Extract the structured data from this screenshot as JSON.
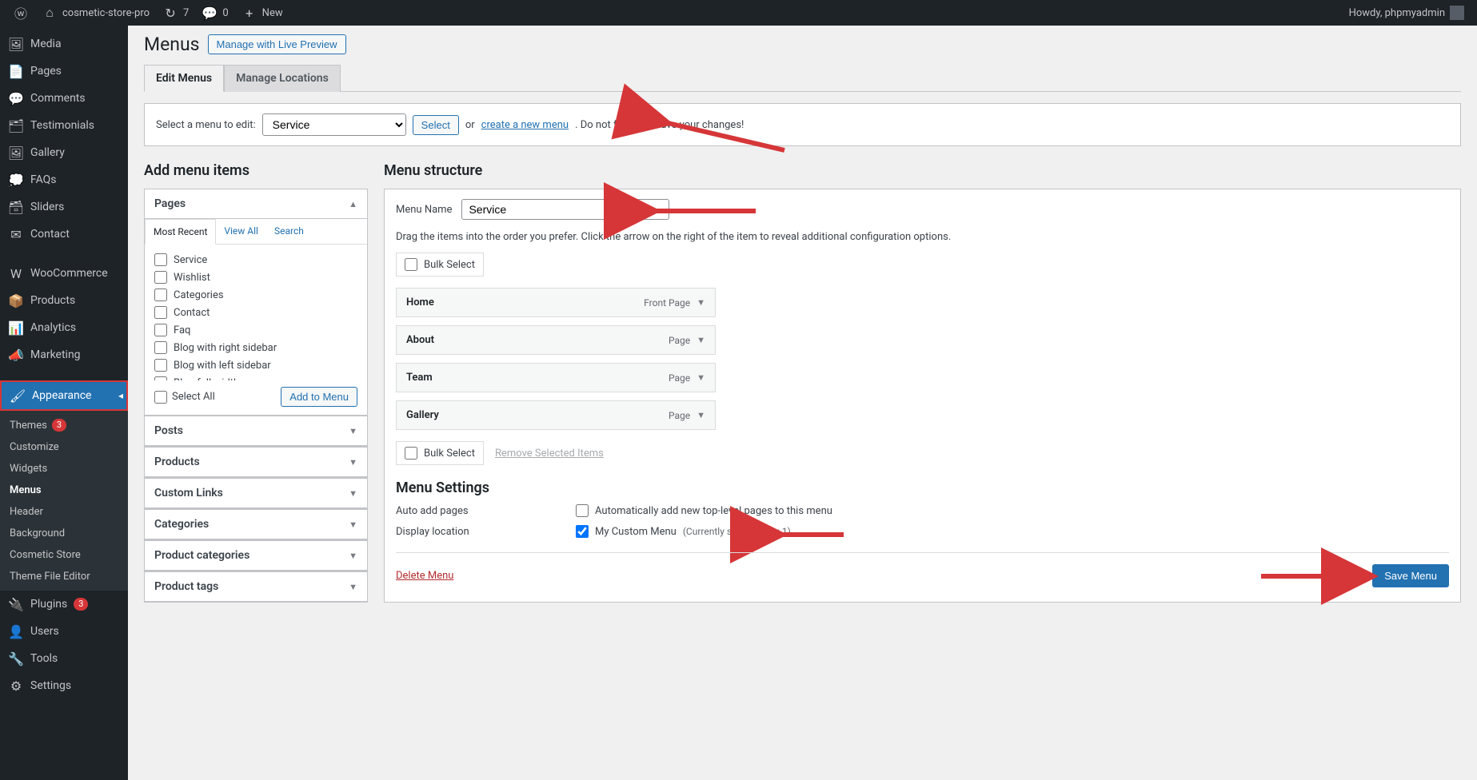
{
  "toolbar": {
    "site_name": "cosmetic-store-pro",
    "updates_count": "7",
    "comments_count": "0",
    "new_label": "New",
    "howdy": "Howdy, phpmyadmin"
  },
  "sidebar": {
    "items": [
      {
        "icon": "media",
        "label": "Media"
      },
      {
        "icon": "pages",
        "label": "Pages"
      },
      {
        "icon": "comments",
        "label": "Comments"
      },
      {
        "icon": "testimonials",
        "label": "Testimonials"
      },
      {
        "icon": "gallery",
        "label": "Gallery"
      },
      {
        "icon": "faqs",
        "label": "FAQs"
      },
      {
        "icon": "sliders",
        "label": "Sliders"
      },
      {
        "icon": "contact",
        "label": "Contact"
      },
      {
        "icon": "woo",
        "label": "WooCommerce"
      },
      {
        "icon": "products",
        "label": "Products"
      },
      {
        "icon": "analytics",
        "label": "Analytics"
      },
      {
        "icon": "marketing",
        "label": "Marketing"
      },
      {
        "icon": "appearance",
        "label": "Appearance",
        "active": true
      },
      {
        "icon": "plugins",
        "label": "Plugins",
        "badge": "3"
      },
      {
        "icon": "users",
        "label": "Users"
      },
      {
        "icon": "tools",
        "label": "Tools"
      },
      {
        "icon": "settings",
        "label": "Settings"
      }
    ],
    "appearance_sub": [
      {
        "label": "Themes",
        "badge": "3"
      },
      {
        "label": "Customize"
      },
      {
        "label": "Widgets"
      },
      {
        "label": "Menus",
        "current": true
      },
      {
        "label": "Header"
      },
      {
        "label": "Background"
      },
      {
        "label": "Cosmetic Store"
      },
      {
        "label": "Theme File Editor"
      }
    ]
  },
  "page": {
    "title": "Menus",
    "live_preview": "Manage with Live Preview",
    "tabs": {
      "edit": "Edit Menus",
      "locations": "Manage Locations"
    },
    "select_label": "Select a menu to edit:",
    "select_value": "Service",
    "select_button": "Select",
    "or": "or",
    "create_link": "create a new menu",
    "reminder": ". Do not forget to save your changes!"
  },
  "add_items": {
    "heading": "Add menu items",
    "accordions": [
      "Pages",
      "Posts",
      "Products",
      "Custom Links",
      "Categories",
      "Product categories",
      "Product tags"
    ],
    "pages_tabs": {
      "recent": "Most Recent",
      "view_all": "View All",
      "search": "Search"
    },
    "pages_list": [
      "Service",
      "Wishlist",
      "Categories",
      "Contact",
      "Faq",
      "Blog with right sidebar",
      "Blog with left sidebar",
      "Blog full width"
    ],
    "select_all": "Select All",
    "add_button": "Add to Menu"
  },
  "structure": {
    "heading": "Menu structure",
    "name_label": "Menu Name",
    "name_value": "Service",
    "hint": "Drag the items into the order you prefer. Click the arrow on the right of the item to reveal additional configuration options.",
    "bulk": "Bulk Select",
    "items": [
      {
        "title": "Home",
        "type": "Front Page"
      },
      {
        "title": "About",
        "type": "Page"
      },
      {
        "title": "Team",
        "type": "Page"
      },
      {
        "title": "Gallery",
        "type": "Page"
      }
    ],
    "remove_selected": "Remove Selected Items",
    "settings_heading": "Menu Settings",
    "auto_add_label": "Auto add pages",
    "auto_add_check": "Automatically add new top-level pages to this menu",
    "display_loc_label": "Display location",
    "display_loc_check": "My Custom Menu",
    "display_loc_note": "(Currently set to: Menu 1)",
    "delete": "Delete Menu",
    "save": "Save Menu"
  }
}
